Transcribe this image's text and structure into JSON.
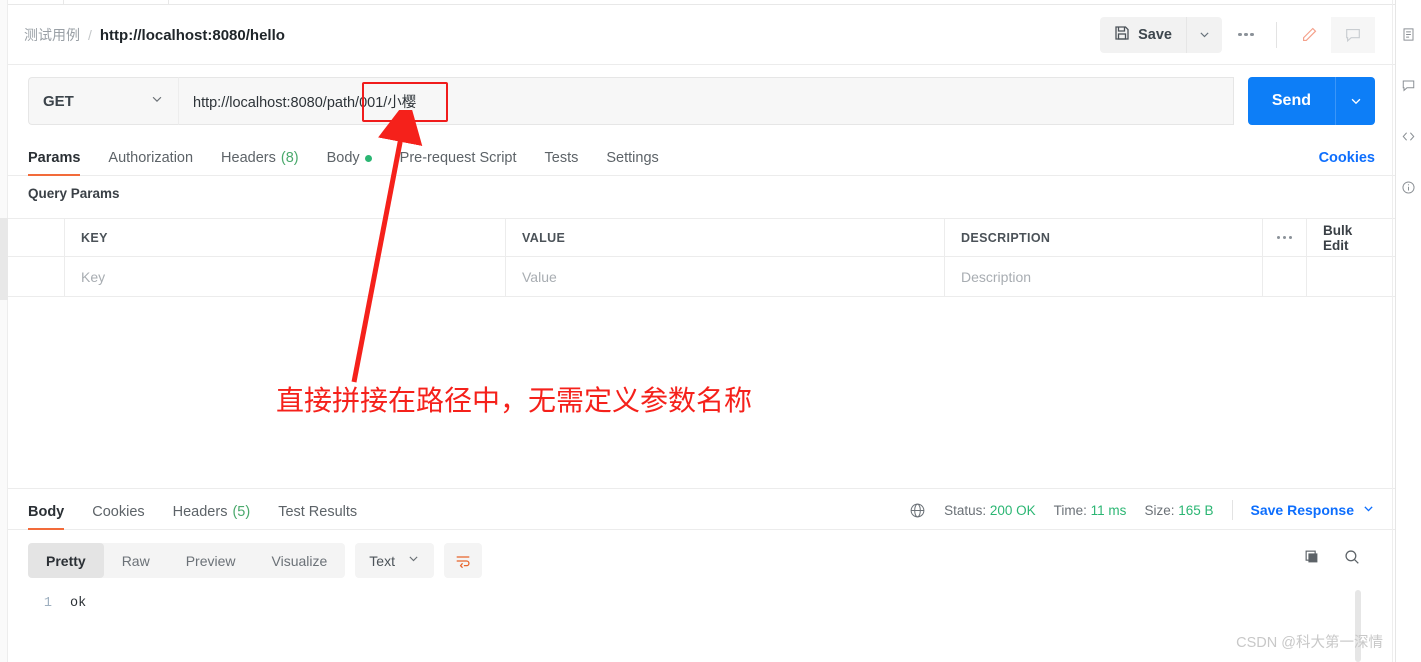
{
  "breadcrumb": {
    "collection": "测试用例",
    "separator": "/",
    "request_name": "http://localhost:8080/hello"
  },
  "header": {
    "save_label": "Save",
    "save_icon": "floppy-disk-icon",
    "caret_icon": "chevron-down-icon",
    "more_icon": "ellipsis-icon",
    "edit_icon": "pencil-icon",
    "comment_icon": "comment-icon"
  },
  "url_bar": {
    "method": "GET",
    "method_caret": "chevron-down-icon",
    "url_prefix": "http://localhost:8080/path",
    "url_highlight": "/001/小樱",
    "url_full": "http://localhost:8080/path/001/小樱",
    "send_label": "Send",
    "send_caret": "chevron-down-icon",
    "highlight_color": "#f01c1c",
    "send_color": "#0d7ef7"
  },
  "request_tabs": [
    {
      "label": "Params",
      "active": true
    },
    {
      "label": "Authorization",
      "active": false
    },
    {
      "label": "Headers",
      "count": "(8)",
      "active": false
    },
    {
      "label": "Body",
      "dot": true,
      "active": false
    },
    {
      "label": "Pre-request Script",
      "active": false
    },
    {
      "label": "Tests",
      "active": false
    },
    {
      "label": "Settings",
      "active": false
    }
  ],
  "cookies_link": "Cookies",
  "query_params": {
    "title": "Query Params",
    "columns": [
      "KEY",
      "VALUE",
      "DESCRIPTION"
    ],
    "row_more_icon": "ellipsis-icon",
    "bulk_edit": "Bulk Edit",
    "rows": [
      {
        "key": "Key",
        "value": "Value",
        "description": "Description"
      }
    ]
  },
  "annotation": {
    "text": "直接拼接在路径中，无需定义参数名称",
    "color": "#f5211b",
    "arrow": "red-arrow"
  },
  "response_tabs": [
    {
      "label": "Body",
      "active": true
    },
    {
      "label": "Cookies",
      "active": false
    },
    {
      "label": "Headers",
      "count": "(5)",
      "active": false
    },
    {
      "label": "Test Results",
      "active": false
    }
  ],
  "response_meta": {
    "globe_icon": "globe-icon",
    "status_label": "Status:",
    "status_value": "200 OK",
    "time_label": "Time:",
    "time_value": "11 ms",
    "size_label": "Size:",
    "size_value": "165 B",
    "save_response": "Save Response",
    "save_caret": "chevron-down-icon",
    "ok_color": "#2bb673"
  },
  "body_toolbar": {
    "views": [
      {
        "label": "Pretty",
        "active": true
      },
      {
        "label": "Raw",
        "active": false
      },
      {
        "label": "Preview",
        "active": false
      },
      {
        "label": "Visualize",
        "active": false
      }
    ],
    "format": "Text",
    "format_caret": "chevron-down-icon",
    "wrap_icon": "wrap-lines-icon",
    "copy_icon": "copy-icon",
    "search_icon": "search-icon"
  },
  "response_body": {
    "lines": [
      {
        "number": "1",
        "text": "ok"
      }
    ]
  },
  "right_rail": [
    {
      "icon": "document-icon"
    },
    {
      "icon": "comment-icon"
    },
    {
      "icon": "code-icon"
    },
    {
      "icon": "info-circle-icon"
    }
  ],
  "watermark": "CSDN @科大第一深情"
}
